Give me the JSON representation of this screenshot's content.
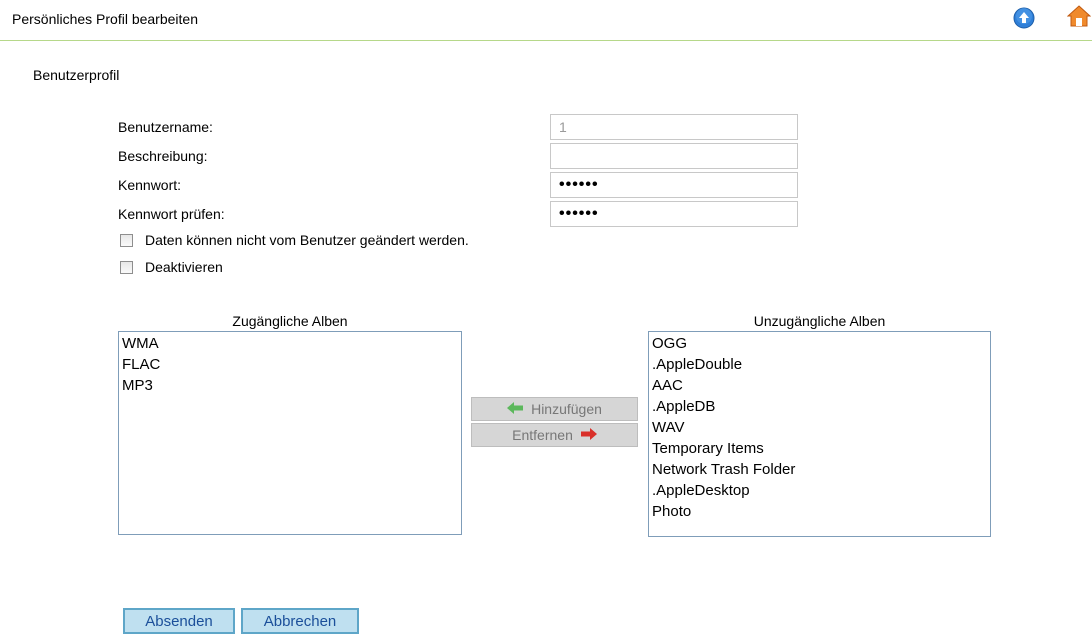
{
  "header": {
    "title": "Persönliches Profil bearbeiten",
    "up_icon": "arrow-up-circle-icon",
    "home_icon": "home-icon"
  },
  "section_title": "Benutzerprofil",
  "form": {
    "username_label": "Benutzername:",
    "username_value": "1",
    "description_label": "Beschreibung:",
    "description_value": "",
    "password_label": "Kennwort:",
    "password_value": "••••••",
    "password_confirm_label": "Kennwort prüfen:",
    "password_confirm_value": "••••••",
    "lock_checkbox_label": "Daten können nicht vom Benutzer geändert werden.",
    "lock_checked": false,
    "disable_checkbox_label": "Deaktivieren",
    "disable_checked": false
  },
  "albums": {
    "accessible_title": "Zugängliche Alben",
    "accessible": [
      "WMA",
      "FLAC",
      "MP3"
    ],
    "inaccessible_title": "Unzugängliche Alben",
    "inaccessible": [
      "OGG",
      ".AppleDouble",
      "AAC",
      ".AppleDB",
      "WAV",
      "Temporary Items",
      "Network Trash Folder",
      ".AppleDesktop",
      "Photo"
    ],
    "add_label": "Hinzufügen",
    "remove_label": "Entfernen"
  },
  "actions": {
    "submit_label": "Absenden",
    "cancel_label": "Abbrechen"
  },
  "colors": {
    "header_line": "#b6d88a",
    "add_arrow": "#5cb85c",
    "remove_arrow": "#d9302a",
    "button_fill": "#bfe0f0"
  }
}
